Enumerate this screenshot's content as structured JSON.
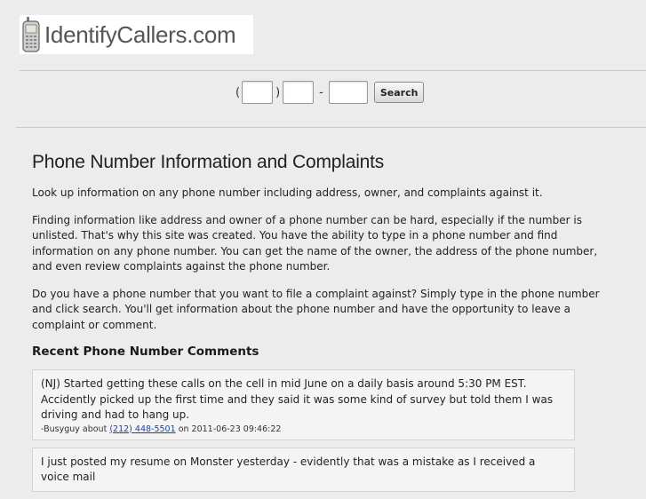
{
  "logo": {
    "text": "IdentifyCallers.com"
  },
  "search": {
    "paren_open": "(",
    "paren_close": ")",
    "dash": "-",
    "button_label": "Search"
  },
  "main": {
    "title": "Phone Number Information and Complaints",
    "paragraphs": [
      "Look up information on any phone number including address, owner, and complaints against it.",
      "Finding information like address and owner of a phone number can be hard, especially if the number is unlisted. That's why this site was created. You have the ability to type in a phone number and find information on any phone number. You can get the name of the owner, the address of the phone number, and even review complaints against the phone number.",
      "Do you have a phone number that you want to file a complaint against? Simply type in the phone number and click search. You'll get information about the phone number and have the opportunity to leave a complaint or comment."
    ],
    "recent_heading": "Recent Phone Number Comments"
  },
  "comments": [
    {
      "text": "(NJ) Started getting these calls on the cell in mid June on a daily basis around 5:30 PM EST. Accidently picked up the first time and they said it was some kind of survey but told them I was driving and had to hang up.",
      "author_prefix": "-Busyguy about",
      "phone": "(212) 448-5501",
      "date_prefix": "on 2011-06-23 09:46:22"
    },
    {
      "text": "I just posted my resume on Monster yesterday - evidently that was a mistake as I received a voice mail",
      "author_prefix": "",
      "phone": "",
      "date_prefix": ""
    }
  ]
}
